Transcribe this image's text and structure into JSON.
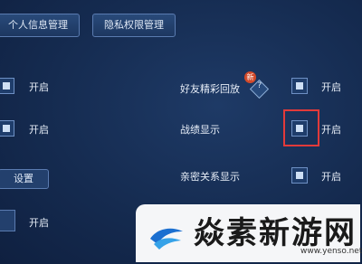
{
  "tabs": {
    "personal_info": "个人信息管理",
    "privacy": "隐私权限管理"
  },
  "rows": {
    "left_1_on": "开启",
    "left_2_on": "开启",
    "left_4_on": "开启",
    "friend_highlights": "好友精彩回放",
    "friend_highlights_on": "开启",
    "badge_new": "新",
    "help_mark": "?",
    "record_display": "战绩显示",
    "record_display_on": "开启",
    "intimate_display": "亲密关系显示",
    "intimate_display_on": "开启"
  },
  "settings_button": "设置",
  "watermark": {
    "title": "焱素新游网",
    "url": "www.yenso.net"
  },
  "colors": {
    "highlight_border": "#e23a3a",
    "panel_bg": "#152b50"
  }
}
